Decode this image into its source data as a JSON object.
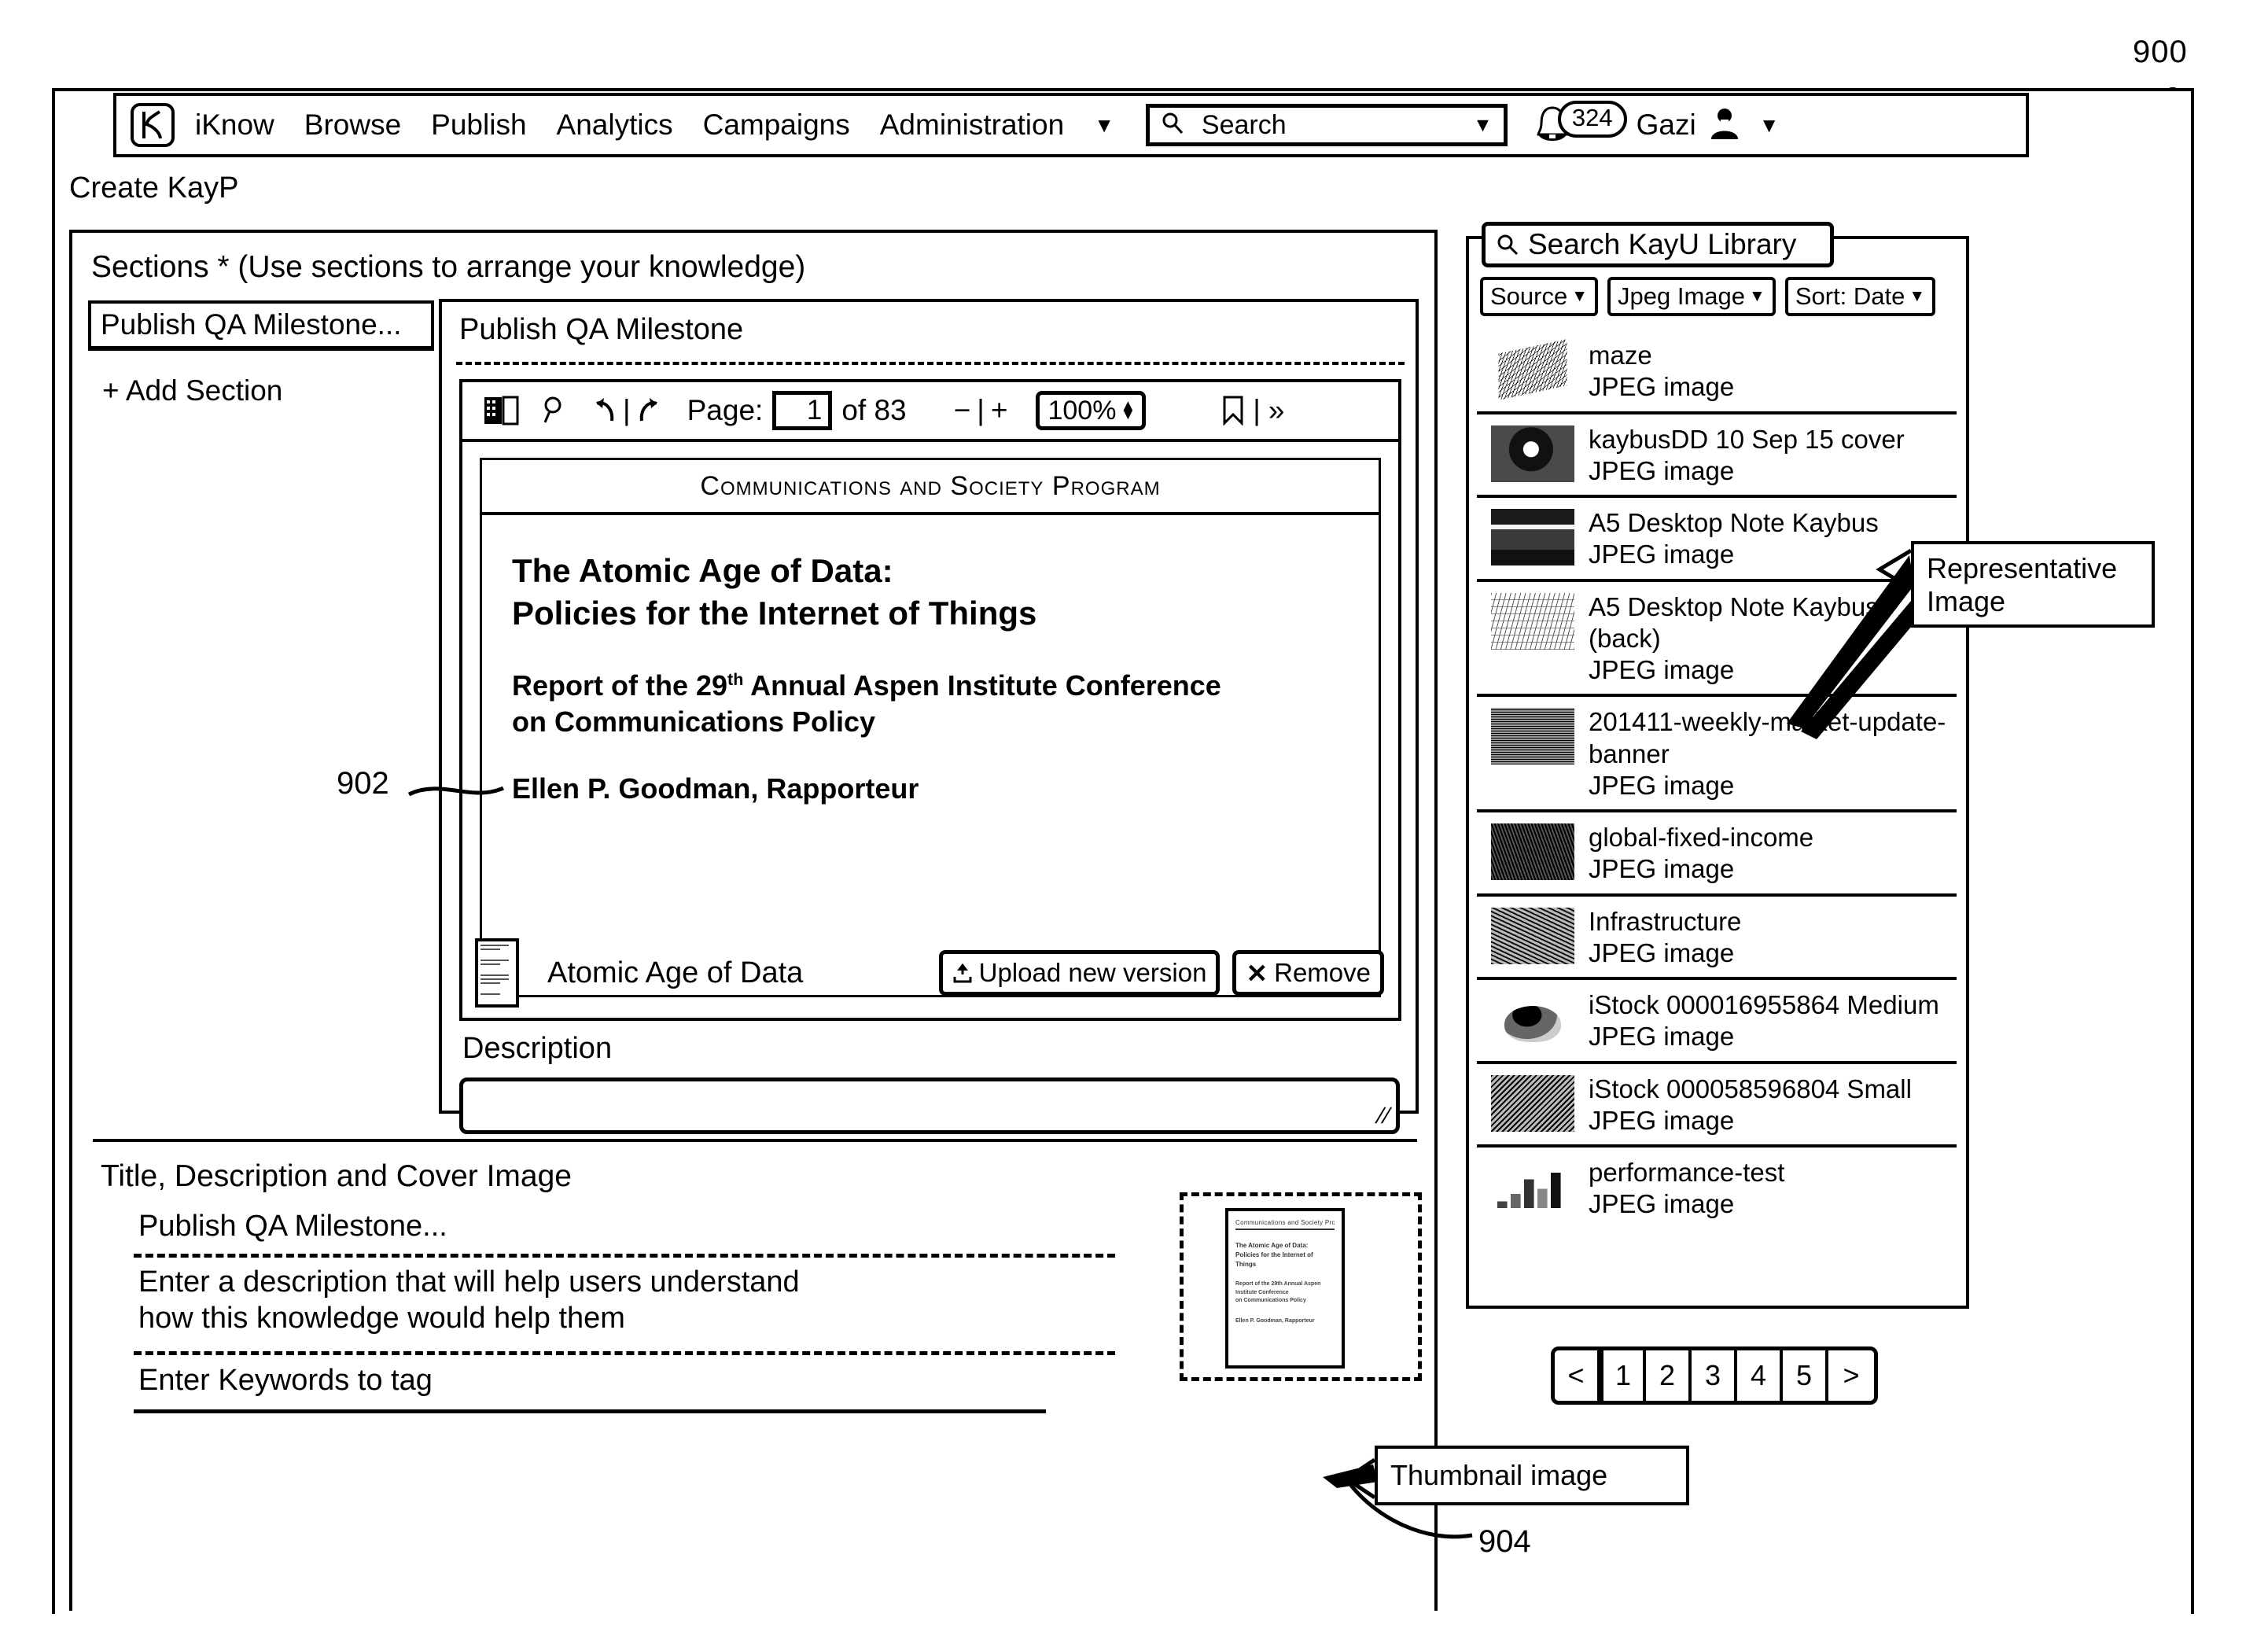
{
  "figure": {
    "number": "900",
    "ref_902": "902",
    "ref_904": "904"
  },
  "topnav": {
    "logo": "k-logo-icon",
    "items": [
      "iKnow",
      "Browse",
      "Publish",
      "Analytics",
      "Campaigns",
      "Administration"
    ],
    "caret": "▼",
    "search": {
      "placeholder": "Search",
      "icon": "search-icon",
      "dropdown_caret": "▼"
    },
    "notifications": {
      "icon": "bell-icon",
      "count": "324"
    },
    "user": {
      "name": "Gazi",
      "avatar": "user-avatar-icon",
      "caret": "▼"
    }
  },
  "breadcrumb": {
    "label": "Create KayP"
  },
  "sections": {
    "label": "Sections *  (Use sections to arrange your knowledge)",
    "items": [
      {
        "label": "Publish QA Milestone..."
      }
    ],
    "add_label": "+ Add Section"
  },
  "section_editor": {
    "title": "Publish QA Milestone",
    "toolbar": {
      "thumbnail_icon": "page-thumbnails-icon",
      "find_icon": "magnifier-icon",
      "rotate_ccw_icon": "rotate-counterclockwise-icon",
      "separator": "|",
      "rotate_cw_icon": "rotate-clockwise-icon",
      "page_label": "Page:",
      "page_value": "1",
      "page_of": "of 83",
      "zoom_out": "−",
      "zoom_sep": "|",
      "zoom_in": "+",
      "zoom_value": "100%",
      "bookmark_icon": "bookmark-icon",
      "tail_separator": "|",
      "more_icon": "»"
    },
    "document": {
      "header": "Communications and Society Program",
      "title_line1": "The Atomic Age of Data:",
      "title_line2": "Policies for the Internet of Things",
      "subtitle_line1": "Report of the 29",
      "subtitle_sup": "th",
      "subtitle_line1b": " Annual Aspen Institute Conference",
      "subtitle_line2": "on Communications Policy",
      "author": "Ellen P. Goodman, Rapporteur"
    },
    "attachment": {
      "thumb": "document-thumbnail",
      "name": "Atomic Age of Data",
      "upload_label": "Upload new version",
      "upload_icon": "upload-icon",
      "remove_label": "Remove",
      "remove_icon": "✕"
    },
    "description": {
      "label": "Description",
      "value": "",
      "placeholder": ""
    }
  },
  "bottom": {
    "heading": "Title, Description and Cover Image",
    "title_value": "Publish QA Milestone...",
    "description_placeholder_line1": "Enter a description that will help users understand",
    "description_placeholder_line2": "how this knowledge would help them",
    "keywords_placeholder": "Enter Keywords to tag",
    "cover_thumb": {
      "header": "Communications and Society Program",
      "title": "The Atomic Age of Data:\nPolicies for the Internet of Things",
      "sub": "Report of the 29th Annual Aspen Institute Conference\non Communications Policy",
      "author": "Ellen P. Goodman, Rapporteur"
    }
  },
  "library": {
    "search_placeholder": "Search KayU Library",
    "search_icon": "search-icon",
    "filters": [
      {
        "label": "Source",
        "caret": "▼"
      },
      {
        "label": "Jpeg Image",
        "caret": "▼"
      },
      {
        "label": "Sort: Date",
        "caret": "▼"
      }
    ],
    "items": [
      {
        "name": "maze",
        "type": "JPEG image",
        "thumb": "th-maze"
      },
      {
        "name": "kaybusDD 10 Sep 15 cover",
        "type": "JPEG image",
        "thumb": "th-face"
      },
      {
        "name": "A5 Desktop Note Kaybus",
        "type": "JPEG image",
        "thumb": "th-note"
      },
      {
        "name": "A5 Desktop Note Kaybus  (back)",
        "type": "JPEG image",
        "thumb": "th-back"
      },
      {
        "name": "201411-weekly-market-update-banner",
        "type": "JPEG image",
        "thumb": "th-banner"
      },
      {
        "name": "global-fixed-income",
        "type": "JPEG image",
        "thumb": "th-dark"
      },
      {
        "name": "Infrastructure",
        "type": "JPEG image",
        "thumb": "th-infra"
      },
      {
        "name": "iStock 000016955864 Medium",
        "type": "JPEG image",
        "thumb": "th-istock1"
      },
      {
        "name": "iStock 000058596804 Small",
        "type": "JPEG image",
        "thumb": "th-istock2"
      },
      {
        "name": "performance-test",
        "type": "JPEG image",
        "thumb": "th-chart"
      }
    ],
    "pagination": {
      "prev": "<",
      "pages": [
        "1",
        "2",
        "3",
        "4",
        "5"
      ],
      "next": ">",
      "active": "1"
    }
  },
  "callouts": {
    "representative_image": "Representative\nImage",
    "representative_image_line1": "Representative",
    "representative_image_line2": "Image",
    "thumbnail_image": "Thumbnail image"
  }
}
